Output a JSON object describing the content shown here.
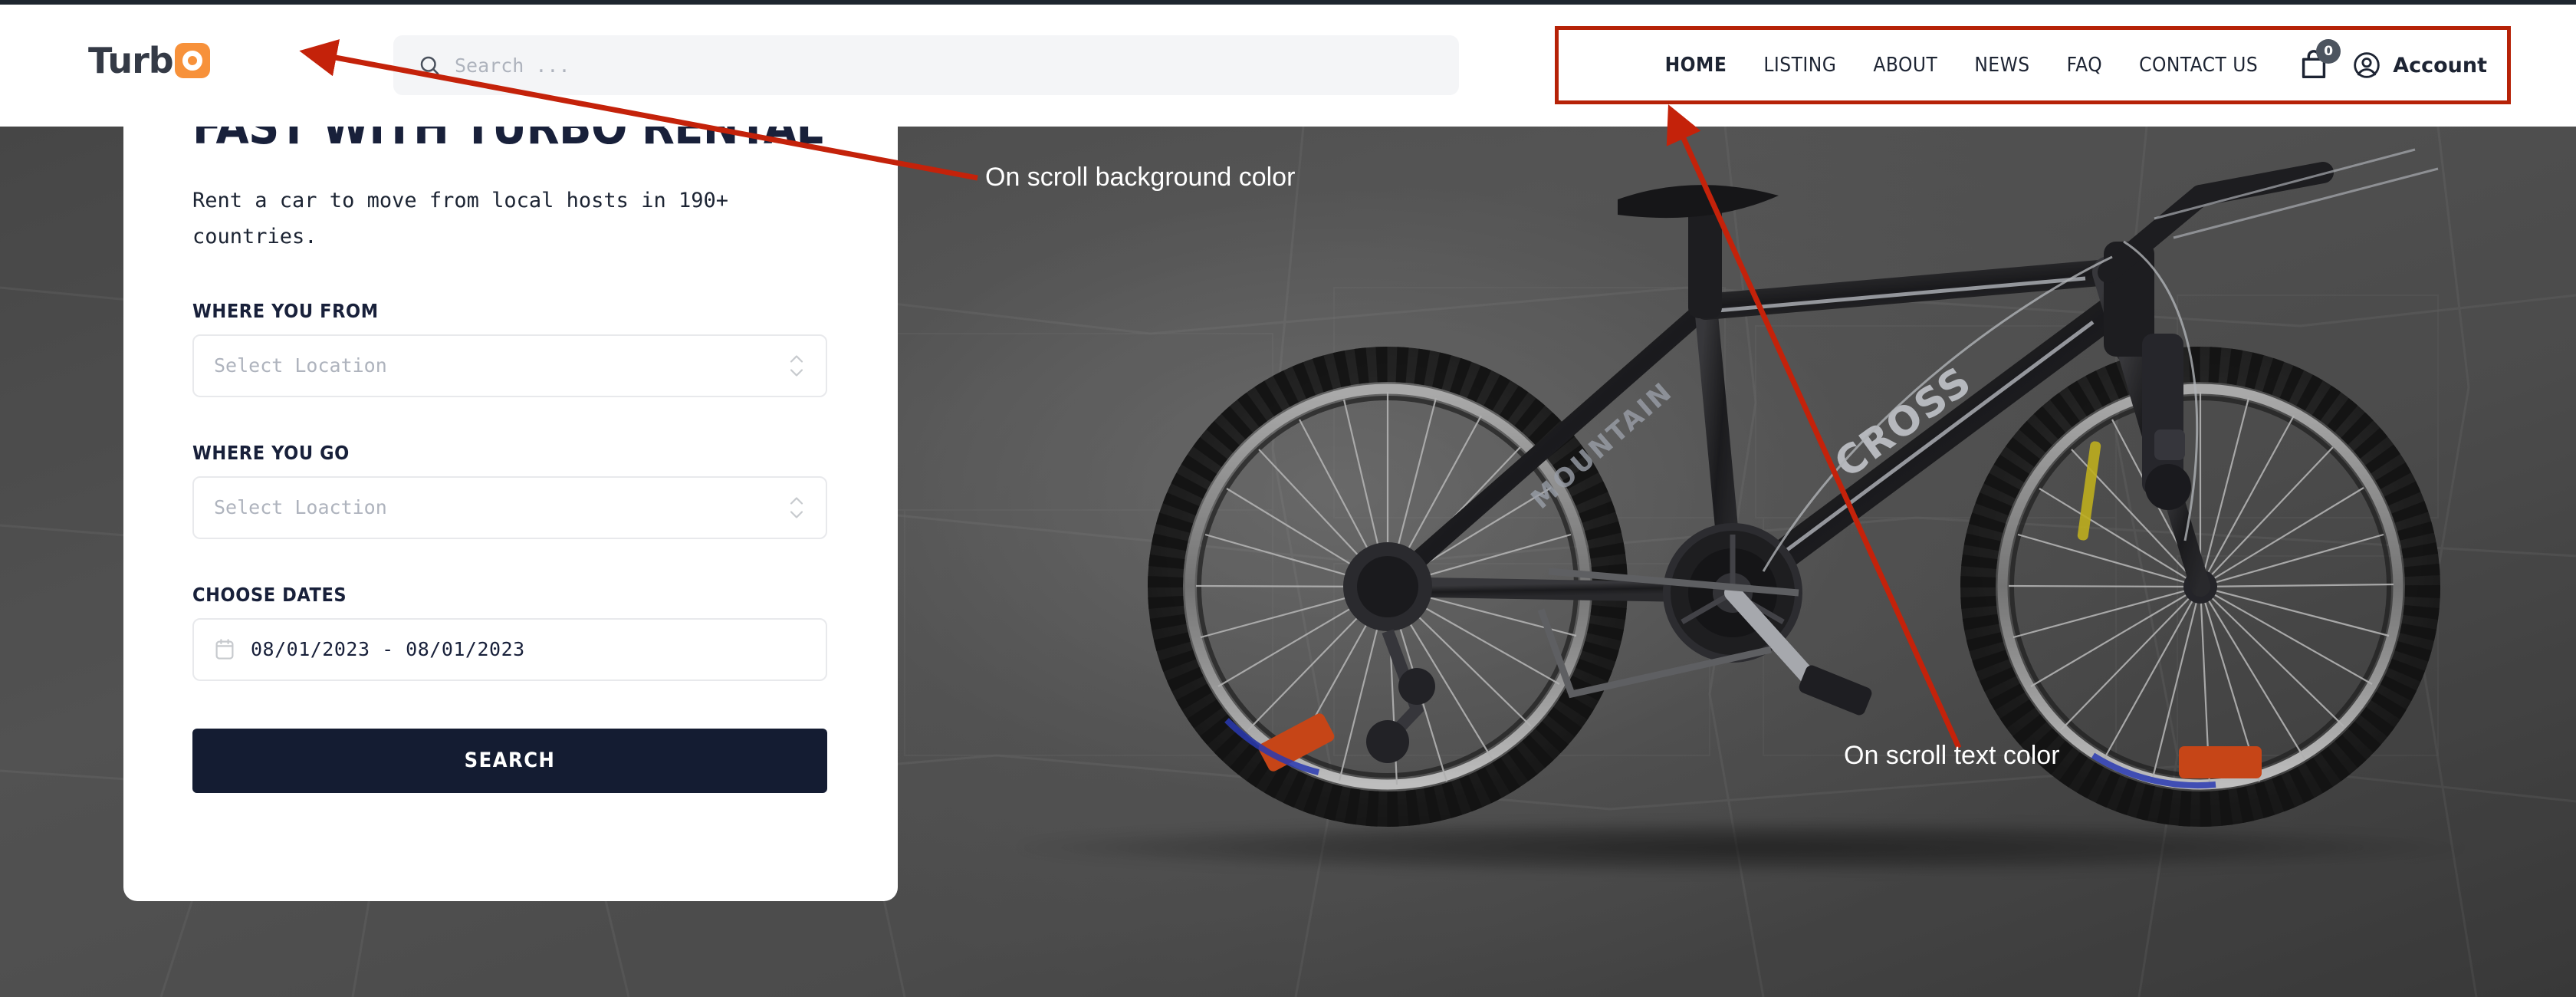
{
  "header": {
    "logo": {
      "text": "Turb",
      "mark_letter": "O",
      "mark_color": "#f7913a",
      "text_color": "#343a46"
    },
    "search": {
      "placeholder": "Search ...",
      "value": "",
      "icon": "search-icon"
    },
    "nav": {
      "items": [
        {
          "label": "HOME",
          "active": true
        },
        {
          "label": "LISTING",
          "active": false
        },
        {
          "label": "ABOUT",
          "active": false
        },
        {
          "label": "NEWS",
          "active": false
        },
        {
          "label": "FAQ",
          "active": false
        },
        {
          "label": "CONTACT US",
          "active": false
        }
      ],
      "cart": {
        "icon": "shopping-bag-icon",
        "badge_count": "0",
        "badge_color": "#4c545f"
      },
      "account": {
        "icon": "user-circle-icon",
        "label": "Account"
      },
      "highlight_border_color": "#b62207"
    }
  },
  "hero": {
    "title": "FAST WITH TURBO RENTAL",
    "subtitle": "Rent a car to move from local hosts in 190+ countries.",
    "form": {
      "from": {
        "label": "WHERE YOU FROM",
        "placeholder": "Select Location",
        "value": "Select Location"
      },
      "to": {
        "label": "WHERE YOU GO",
        "placeholder": "Select Loaction",
        "value": "Select Loaction"
      },
      "dates": {
        "label": "CHOOSE DATES",
        "value": "08/01/2023 - 08/01/2023",
        "icon": "calendar-icon"
      },
      "submit_label": "SEARCH",
      "submit_color": "#141c32"
    },
    "background_color": "#4a4a4a"
  },
  "annotations": {
    "background_note": "On scroll background color",
    "text_note": "On scroll text color",
    "arrow_color": "#c4220a"
  }
}
